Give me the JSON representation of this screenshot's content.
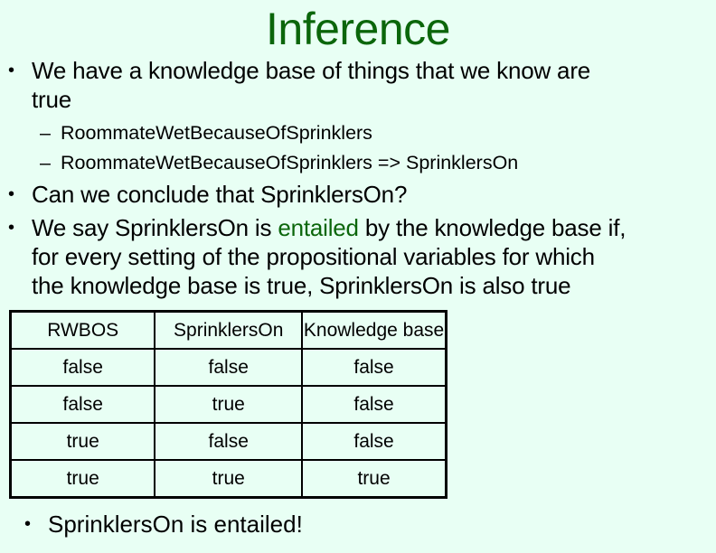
{
  "slide": {
    "title": "Inference",
    "bullets": [
      {
        "line1": "We have a knowledge base of things that we know are",
        "line2": "true"
      },
      {
        "text": "Can we conclude that SprinklersOn?"
      },
      {
        "pre": "We say SprinklersOn is ",
        "highlight": "entailed",
        "post": " by the knowledge base if,",
        "line2": "for every setting of the propositional variables for which",
        "line3": "the knowledge base is true, SprinklersOn is also true"
      }
    ],
    "sub_bullets": [
      "RoommateWetBecauseOfSprinklers",
      "RoommateWetBecauseOfSprinklers => SprinklersOn"
    ],
    "bullet_glyph": "•",
    "dash_glyph": "–",
    "accent_color": "#0b660b",
    "background_color": "#e8fff4",
    "conclusion": "SprinklersOn is entailed!"
  },
  "truth_table": {
    "headers": [
      "RWBOS",
      "SprinklersOn",
      "Knowledge base"
    ],
    "rows": [
      [
        "false",
        "false",
        "false"
      ],
      [
        "false",
        "true",
        "false"
      ],
      [
        "true",
        "false",
        "false"
      ],
      [
        "true",
        "true",
        "true"
      ]
    ]
  }
}
